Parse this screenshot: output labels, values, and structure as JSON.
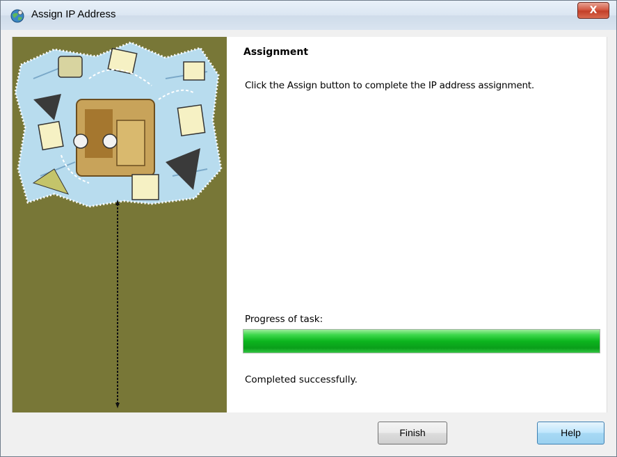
{
  "window": {
    "title": "Assign IP Address",
    "close_label": "X"
  },
  "page": {
    "heading": "Assignment",
    "instruction": "Click the Assign button to complete the IP address assignment.",
    "progress_label": "Progress of task:",
    "progress_value": 1.0,
    "status": "Completed successfully."
  },
  "footer": {
    "finish_label": "Finish",
    "help_label": "Help"
  },
  "colors": {
    "side_panel": "#787737",
    "progress": "#0cb51e",
    "close": "#c33f28"
  },
  "icons": {
    "app": "globe-network-icon",
    "side_art": "assignment-illustration"
  }
}
